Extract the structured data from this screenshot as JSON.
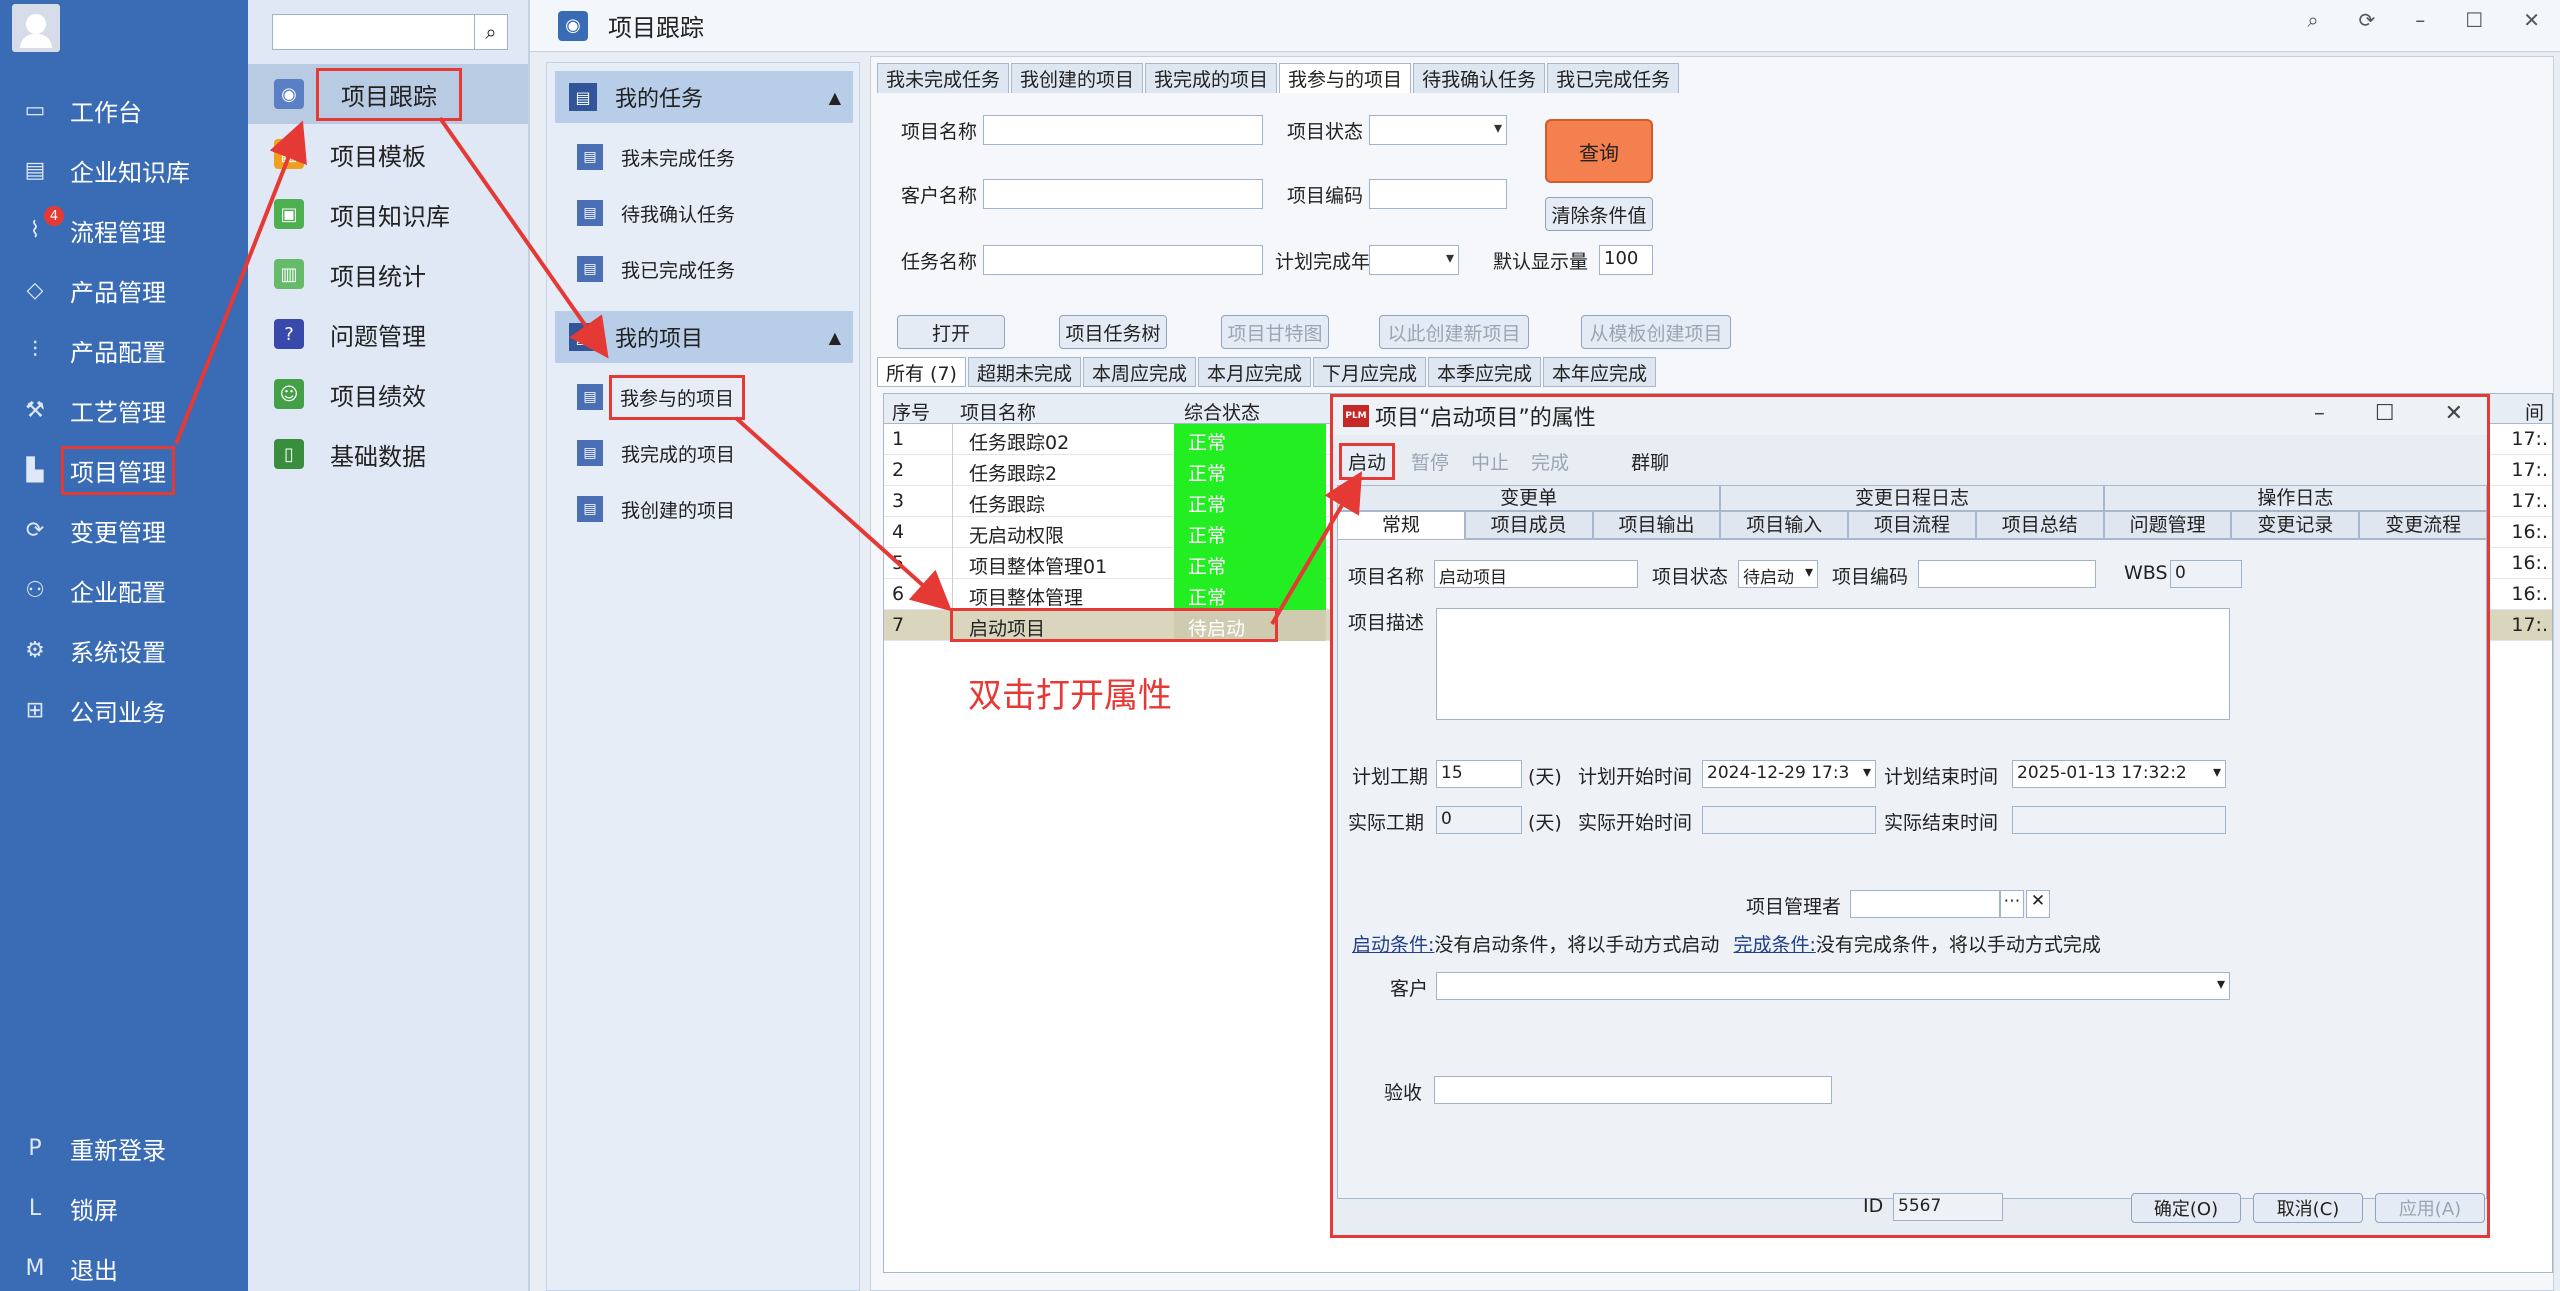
{
  "leftnav": {
    "items": [
      {
        "icon": "monitor-icon",
        "glyph": "▭",
        "label": "工作台"
      },
      {
        "icon": "knowledge-icon",
        "glyph": "▤",
        "label": "企业知识库"
      },
      {
        "icon": "flow-icon",
        "glyph": "⌇",
        "label": "流程管理",
        "badge": "4"
      },
      {
        "icon": "cube-icon",
        "glyph": "◇",
        "label": "产品管理"
      },
      {
        "icon": "sliders-icon",
        "glyph": "⫶",
        "label": "产品配置"
      },
      {
        "icon": "wrench-icon",
        "glyph": "⚒",
        "label": "工艺管理"
      },
      {
        "icon": "project-icon",
        "glyph": "▙",
        "label": "项目管理"
      },
      {
        "icon": "change-icon",
        "glyph": "⟳",
        "label": "变更管理"
      },
      {
        "icon": "org-icon",
        "glyph": "⚇",
        "label": "企业配置"
      },
      {
        "icon": "gear-icon",
        "glyph": "⚙",
        "label": "系统设置"
      },
      {
        "icon": "apps-icon",
        "glyph": "⊞",
        "label": "公司业务"
      }
    ],
    "bottom": [
      {
        "key": "P",
        "label": "重新登录"
      },
      {
        "key": "L",
        "label": "锁屏"
      },
      {
        "key": "M",
        "label": "退出"
      }
    ]
  },
  "modlist": {
    "items": [
      {
        "icon": "location-icon",
        "label": "项目跟踪",
        "color": "#5b7fc4"
      },
      {
        "icon": "template-icon",
        "label": "项目模板",
        "color": "#f0a020"
      },
      {
        "icon": "book-icon",
        "label": "项目知识库",
        "color": "#4caf50"
      },
      {
        "icon": "stats-icon",
        "label": "项目统计",
        "color": "#66bb6a"
      },
      {
        "icon": "question-icon",
        "label": "问题管理",
        "color": "#3949ab"
      },
      {
        "icon": "performance-icon",
        "label": "项目绩效",
        "color": "#43a047"
      },
      {
        "icon": "data-icon",
        "label": "基础数据",
        "color": "#388e3c"
      }
    ]
  },
  "header": {
    "title": "项目跟踪"
  },
  "taskpanel": {
    "my_tasks": "我的任务",
    "tasks": [
      "我未完成任务",
      "待我确认任务",
      "我已完成任务"
    ],
    "my_projects": "我的项目",
    "projects": [
      "我参与的项目",
      "我完成的项目",
      "我创建的项目"
    ]
  },
  "main": {
    "tabs": [
      "我未完成任务",
      "我创建的项目",
      "我完成的项目",
      "我参与的项目",
      "待我确认任务",
      "我已完成任务"
    ],
    "form": {
      "project_name": "项目名称",
      "project_status": "项目状态",
      "customer_name": "客户名称",
      "project_code": "项目编码",
      "task_name": "任务名称",
      "plan_finish_year": "计划完成年",
      "default_show": "默认显示量",
      "default_show_value": "100",
      "query": "查询",
      "clear": "清除条件值"
    },
    "buttons": [
      "打开",
      "项目任务树",
      "项目甘特图",
      "以此创建新项目",
      "从模板创建项目"
    ],
    "subtabs": [
      "所有 (7)",
      "超期未完成",
      "本周应完成",
      "本月应完成",
      "下月应完成",
      "本季应完成",
      "本年应完成"
    ],
    "grid": {
      "headers": [
        "序号",
        "项目名称",
        "综合状态",
        "间"
      ],
      "rows": [
        {
          "no": "1",
          "name": "任务跟踪02",
          "status": "正常",
          "time": "17:."
        },
        {
          "no": "2",
          "name": "任务跟踪2",
          "status": "正常",
          "time": "17:."
        },
        {
          "no": "3",
          "name": "任务跟踪",
          "status": "正常",
          "time": "17:."
        },
        {
          "no": "4",
          "name": "无启动权限",
          "status": "正常",
          "time": "16:."
        },
        {
          "no": "5",
          "name": "项目整体管理01",
          "status": "正常",
          "time": "16:."
        },
        {
          "no": "6",
          "name": "项目整体管理",
          "status": "正常",
          "time": "16:."
        },
        {
          "no": "7",
          "name": "启动项目",
          "status": "待启动",
          "time": "17:."
        }
      ]
    }
  },
  "annotation": "双击打开属性",
  "dialog": {
    "title": "项目“启动项目”的属性",
    "toolbar": [
      "启动",
      "暂停",
      "中止",
      "完成",
      "群聊"
    ],
    "tabs_row1": [
      "变更单",
      "变更日程日志",
      "操作日志"
    ],
    "tabs_row2": [
      "常规",
      "项目成员",
      "项目输出",
      "项目输入",
      "项目流程",
      "项目总结",
      "问题管理",
      "变更记录",
      "变更流程"
    ],
    "fields": {
      "project_name_label": "项目名称",
      "project_name": "启动项目",
      "status_label": "项目状态",
      "status": "待启动",
      "code_label": "项目编码",
      "code": "",
      "wbs_label": "WBS",
      "wbs": "0",
      "desc_label": "项目描述",
      "plan_days_label": "计划工期",
      "plan_days": "15",
      "days_unit": "(天)",
      "plan_start_label": "计划开始时间",
      "plan_start": "2024-12-29 17:3",
      "plan_end_label": "计划结束时间",
      "plan_end": "2025-01-13 17:32:2",
      "actual_days_label": "实际工期",
      "actual_days": "0",
      "actual_start_label": "实际开始时间",
      "actual_end_label": "实际结束时间",
      "manager_label": "项目管理者",
      "start_cond_link": "启动条件:",
      "start_cond_text": "没有启动条件，将以手动方式启动",
      "finish_cond_link": "完成条件:",
      "finish_cond_text": "没有完成条件，将以手动方式完成",
      "customer_label": "客户",
      "accept_label": "验收",
      "id_label": "ID",
      "id": "5567"
    },
    "ok": "确定(O)",
    "cancel": "取消(C)",
    "apply": "应用(A)"
  },
  "colors": {
    "nav_bg": "#3a6bb5",
    "status_ok": "#22ee22",
    "highlight": "#e53935"
  }
}
